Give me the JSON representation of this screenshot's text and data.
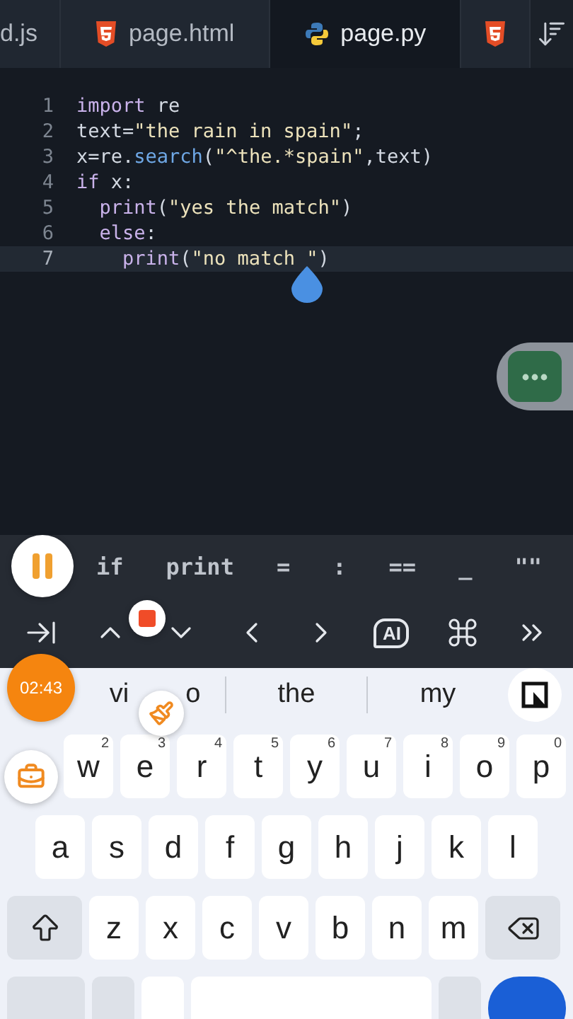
{
  "tabs": [
    {
      "label": "d.js",
      "selected": false
    },
    {
      "label": "page.html",
      "selected": false
    },
    {
      "label": "page.py",
      "selected": true
    },
    {
      "selected": false
    }
  ],
  "code": [
    {
      "number": "1",
      "current": false,
      "segments": [
        {
          "kind": "keyword",
          "text": "import "
        },
        {
          "kind": "plain",
          "text": "re"
        }
      ]
    },
    {
      "number": "2",
      "current": false,
      "segments": [
        {
          "kind": "plain",
          "text": "text="
        },
        {
          "kind": "string",
          "text": "\"the rain in spain\""
        },
        {
          "kind": "plain",
          "text": ";"
        }
      ]
    },
    {
      "number": "3",
      "current": false,
      "segments": [
        {
          "kind": "plain",
          "text": "x=re."
        },
        {
          "kind": "function",
          "text": "search"
        },
        {
          "kind": "plain",
          "text": "("
        },
        {
          "kind": "string",
          "text": "\"^the.*spain\""
        },
        {
          "kind": "plain",
          "text": ",text)"
        }
      ]
    },
    {
      "number": "4",
      "current": false,
      "segments": [
        {
          "kind": "keyword",
          "text": "if"
        },
        {
          "kind": "plain",
          "text": " x:"
        }
      ]
    },
    {
      "number": "5",
      "current": false,
      "segments": [
        {
          "kind": "keyword",
          "text": "  print"
        },
        {
          "kind": "plain",
          "text": "("
        },
        {
          "kind": "string",
          "text": "\"yes the match\""
        },
        {
          "kind": "plain",
          "text": ")"
        }
      ]
    },
    {
      "number": "6",
      "current": false,
      "segments": [
        {
          "kind": "keyword",
          "text": "  else"
        },
        {
          "kind": "plain",
          "text": ":"
        }
      ]
    },
    {
      "number": "7",
      "current": true,
      "segments": [
        {
          "kind": "keyword",
          "text": "    print"
        },
        {
          "kind": "plain",
          "text": "("
        },
        {
          "kind": "string",
          "text": "\"no match \""
        },
        {
          "kind": "plain",
          "text": ")"
        }
      ]
    }
  ],
  "snippets": [
    "if",
    "print",
    "=",
    ":",
    "==",
    "_",
    "\"\""
  ],
  "key_bar": [
    {
      "kind": "tab"
    },
    {
      "kind": "up"
    },
    {
      "kind": "down"
    },
    {
      "kind": "left"
    },
    {
      "kind": "right"
    },
    {
      "kind": "ai",
      "label": "AI"
    },
    {
      "kind": "command"
    },
    {
      "kind": "more"
    }
  ],
  "recorder": {
    "timer": "02:43"
  },
  "suggestions": [
    {
      "parts": [
        "vi",
        "o"
      ]
    },
    {
      "parts": [
        "the"
      ]
    },
    {
      "parts": [
        "my"
      ]
    }
  ],
  "keyboard": {
    "rows": [
      [
        {
          "kind": "hidden"
        },
        {
          "label": "w",
          "hint": "2"
        },
        {
          "label": "e",
          "hint": "3"
        },
        {
          "label": "r",
          "hint": "4"
        },
        {
          "label": "t",
          "hint": "5"
        },
        {
          "label": "y",
          "hint": "6"
        },
        {
          "label": "u",
          "hint": "7"
        },
        {
          "label": "i",
          "hint": "8"
        },
        {
          "label": "o",
          "hint": "9"
        },
        {
          "label": "p",
          "hint": "0"
        }
      ],
      [
        {
          "label": "a"
        },
        {
          "label": "s"
        },
        {
          "label": "d"
        },
        {
          "label": "f"
        },
        {
          "label": "g"
        },
        {
          "label": "h"
        },
        {
          "label": "j"
        },
        {
          "label": "k"
        },
        {
          "label": "l"
        }
      ],
      [
        {
          "kind": "shift"
        },
        {
          "label": "z"
        },
        {
          "label": "x"
        },
        {
          "label": "c"
        },
        {
          "label": "v"
        },
        {
          "label": "b"
        },
        {
          "label": "n"
        },
        {
          "label": "m"
        },
        {
          "kind": "backspace"
        }
      ]
    ]
  }
}
